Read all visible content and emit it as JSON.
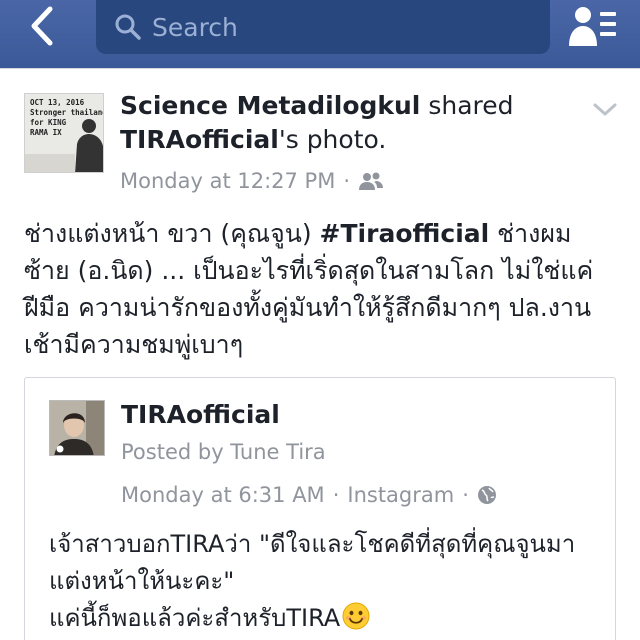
{
  "topbar": {
    "search_placeholder": "Search",
    "icons": {
      "back": "chevron-left-icon",
      "search": "search-icon",
      "friends": "friend-requests-icon"
    },
    "colors": {
      "bar": "#3b5998",
      "search_bg": "#29477f"
    }
  },
  "post": {
    "author": "Science  Metadilogkul",
    "action": "shared",
    "shared_owner": "TIRAofficial",
    "shared_suffix": "'s photo.",
    "timestamp": "Monday at 12:27 PM",
    "separator": "·",
    "privacy_icon": "friends-icon",
    "avatar_text": [
      "OCT 13, 2016",
      "Stronger thailand",
      "for KING",
      "RAMA IX"
    ],
    "body_before_tag": "ช่างแต่งหน้า ขวา (คุณจูน) ",
    "hashtag": "#Tiraofficial",
    "body_after_tag": " ช่างผม ซ้าย (อ.นิด) ... เป็นอะไรที่เริ่ดสุดในสามโลก ไม่ใช่แค่ฝีมือ ความน่ารักของทั้งคู่มันทำให้รู้สึกดีมากๆ ปล.งานเช้ามีความชมพู่เบาๆ"
  },
  "shared": {
    "name": "TIRAofficial",
    "posted_by": "Posted by Tune Tira",
    "timestamp": "Monday at 6:31 AM",
    "separator": "·",
    "source": "Instagram",
    "privacy_icon": "globe-icon",
    "line1": "เจ้าสาวบอกTIRAว่า \"ดีใจและโชคดีที่สุดที่คุณจูนมาแต่งหน้าให้นะคะ\"",
    "line2": "แค่นี้ก็พอแล้วค่ะสำหรับTIRA",
    "emoji_icon": "smiling-face-icon"
  }
}
